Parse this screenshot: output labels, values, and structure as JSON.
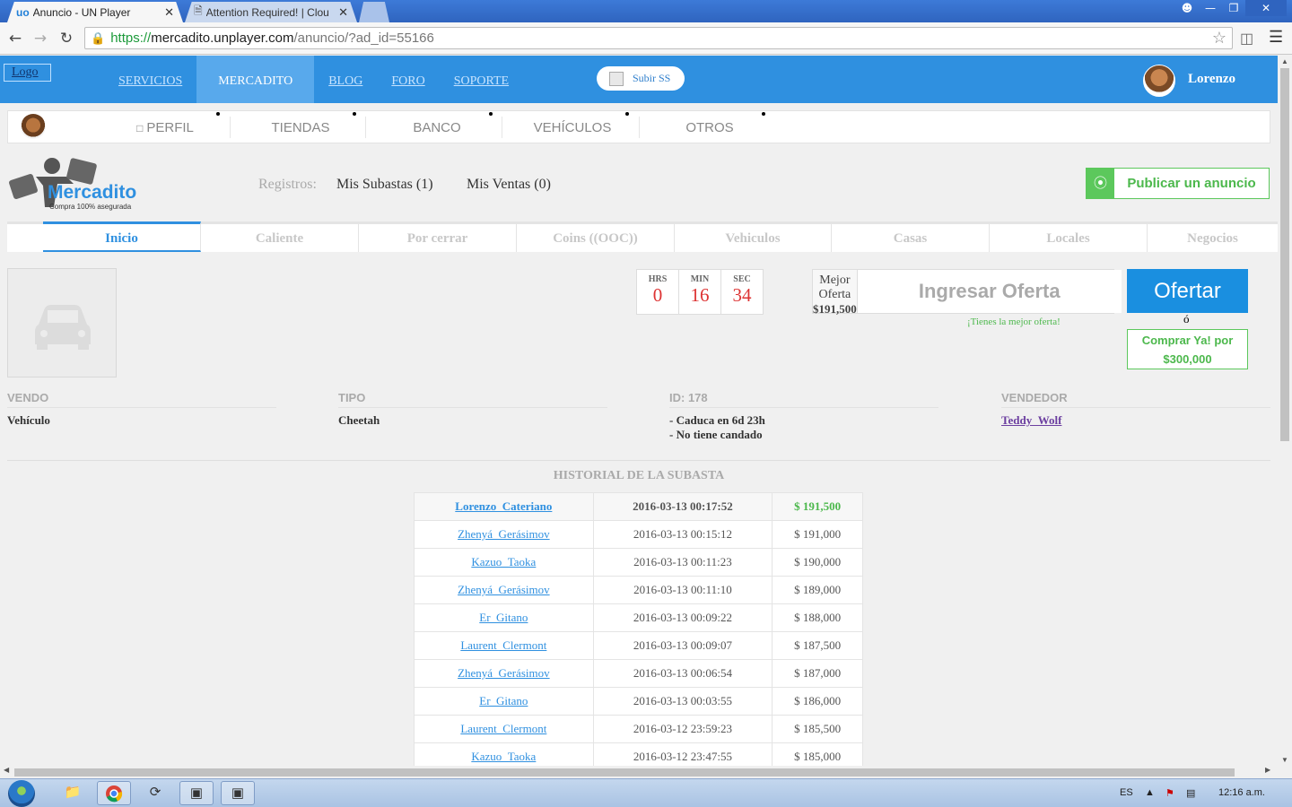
{
  "browser": {
    "tabs": [
      {
        "favicon": "uo",
        "label": "Anuncio - UN Player",
        "close": "✕"
      },
      {
        "favicon": "page-icon",
        "label": "Attention Required! | Clou",
        "close": "✕"
      }
    ],
    "url": {
      "scheme": "https://",
      "host": "mercadito.unplayer.com",
      "path": "/anuncio/?ad_id=55166"
    }
  },
  "header": {
    "logo_alt": "Logo",
    "nav": [
      "SERVICIOS",
      "MERCADITO",
      "BLOG",
      "FORO",
      "SOPORTE"
    ],
    "active_nav": "MERCADITO",
    "subir_label": "Subir SS",
    "user_name": "Lorenzo"
  },
  "subnav": {
    "items": [
      "PERFIL",
      "TIENDAS",
      "BANCO",
      "VEHÍCULOS",
      "OTROS"
    ]
  },
  "mercadito": {
    "brand": "Mercadito",
    "tagline": "Compra 100% asegurada",
    "registros_label": "Registros:",
    "mis_subastas": "Mis Subastas (1)",
    "mis_ventas": "Mis Ventas (0)",
    "publicar_label": "Publicar un anuncio"
  },
  "categories": [
    "Inicio",
    "Caliente",
    "Por cerrar",
    "Coins ((OOC))",
    "Vehiculos",
    "Casas",
    "Locales",
    "Negocios"
  ],
  "auction": {
    "timer": {
      "hrs_label": "HRS",
      "hrs": "0",
      "min_label": "MIN",
      "min": "16",
      "sec_label": "SEC",
      "sec": "34"
    },
    "mejor_oferta_label": "Mejor Oferta",
    "mejor_oferta_value": "$191,500",
    "input_placeholder": "Ingresar Oferta",
    "best_msg": "¡Tienes la mejor oferta!",
    "ofertar_label": "Ofertar",
    "or_label": "ó",
    "comprar_line1": "Comprar Ya! por",
    "comprar_line2": "$300,000"
  },
  "info": {
    "vendo_label": "VENDO",
    "vendo_value": "Vehículo",
    "tipo_label": "TIPO",
    "tipo_value": "Cheetah",
    "id_label": "ID: 178",
    "id_line1": "- Caduca en 6d 23h",
    "id_line2": "- No tiene candado",
    "vendedor_label": "VENDEDOR",
    "vendedor_value": "Teddy_Wolf"
  },
  "history": {
    "title": "HISTORIAL DE LA SUBASTA",
    "rows": [
      {
        "user": "Lorenzo_Cateriano",
        "date": "2016-03-13 00:17:52",
        "amount": "$ 191,500"
      },
      {
        "user": "Zhenyá_Gerásimov",
        "date": "2016-03-13 00:15:12",
        "amount": "$ 191,000"
      },
      {
        "user": "Kazuo_Taoka",
        "date": "2016-03-13 00:11:23",
        "amount": "$ 190,000"
      },
      {
        "user": "Zhenyá_Gerásimov",
        "date": "2016-03-13 00:11:10",
        "amount": "$ 189,000"
      },
      {
        "user": "Er_Gitano",
        "date": "2016-03-13 00:09:22",
        "amount": "$ 188,000"
      },
      {
        "user": "Laurent_Clermont",
        "date": "2016-03-13 00:09:07",
        "amount": "$ 187,500"
      },
      {
        "user": "Zhenyá_Gerásimov",
        "date": "2016-03-13 00:06:54",
        "amount": "$ 187,000"
      },
      {
        "user": "Er_Gitano",
        "date": "2016-03-13 00:03:55",
        "amount": "$ 186,000"
      },
      {
        "user": "Laurent_Clermont",
        "date": "2016-03-12 23:59:23",
        "amount": "$ 185,500"
      },
      {
        "user": "Kazuo_Taoka",
        "date": "2016-03-12 23:47:55",
        "amount": "$ 185,000"
      }
    ]
  },
  "taskbar": {
    "lang": "ES",
    "clock": "12:16 a.m."
  },
  "colors": {
    "brand_blue": "#2f90e0",
    "accent_green": "#4cb84c",
    "timer_red": "#dd3333"
  }
}
